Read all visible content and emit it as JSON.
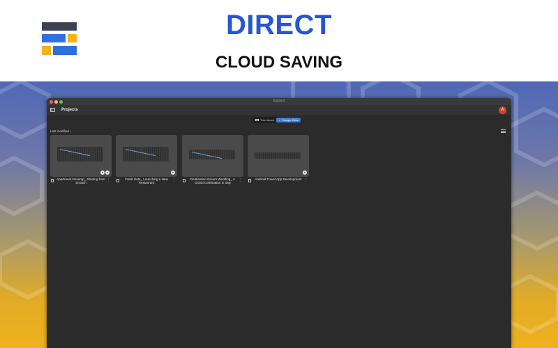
{
  "banner": {
    "headline": "DIRECT",
    "subheadline": "CLOUD SAVING",
    "headline_color": "#2456d6"
  },
  "window": {
    "title": "Ingoant",
    "header": {
      "title": "Projects",
      "avatar_initial": "A"
    },
    "storage_toggle": {
      "options": [
        {
          "label": "This device",
          "icon": "laptop-icon",
          "active": false
        },
        {
          "label": "Google Drive",
          "icon": "drive-icon",
          "active": true
        }
      ]
    },
    "sort_label": "Last modified",
    "projects": [
      {
        "title": "Apartment Revamp_ Starting from Scratch",
        "badges": 2
      },
      {
        "title": "Fresh Eats_ Launching a New Restaurant",
        "badges": 1
      },
      {
        "title": "Destination Dream Wedding_ A Grand Celebration in Italy",
        "badges": 0
      },
      {
        "title": "Android Travel App Development",
        "badges": 1
      }
    ]
  },
  "colors": {
    "accent": "#3b7ddd",
    "logo_dark": "#3c4252",
    "logo_blue": "#2f6fe0",
    "logo_yellow": "#f2b21c"
  }
}
